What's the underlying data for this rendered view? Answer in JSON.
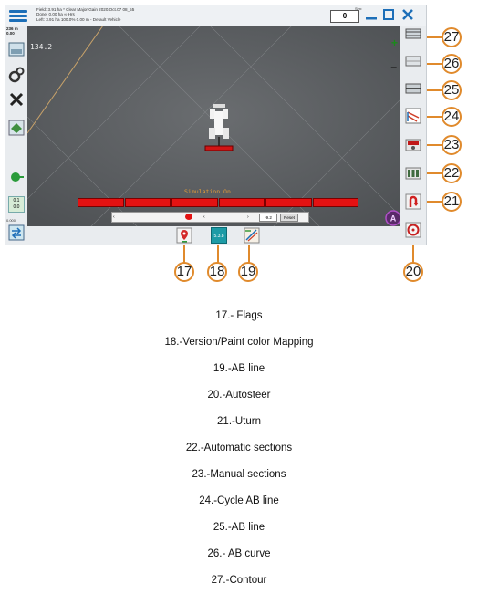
{
  "app": {
    "info_line1": "Field: 3.91 ha   * Clear Major Gain 2020.Oct.07 08_55",
    "info_line2": "Done: 0.00 ha  ∞ Hrs",
    "info_line3": "Left: 3.91 ha  100.0%      0.00 m - Default Vehicle",
    "sim_label": "Sim:",
    "counter": "0",
    "left_scale": "236 m",
    "left_value": "0.00",
    "heading": "134.2",
    "zoom_plus": "+",
    "zoom_minus": "–",
    "simulation_label": "Simulation On",
    "offset_label": "0.1",
    "offset_value": "0.0",
    "bottom_left_value": "0.000",
    "speed_value": "-9.2",
    "reset_label": "Reset",
    "version_label": "5.3.8"
  },
  "callouts": {
    "c17": "17",
    "c18": "18",
    "c19": "19",
    "c20": "20",
    "c21": "21",
    "c22": "22",
    "c23": "23",
    "c24": "24",
    "c25": "25",
    "c26": "26",
    "c27": "27"
  },
  "legend": [
    "17.- Flags",
    "18.-Version/Paint color Mapping",
    "19.-AB line",
    "20.-Autosteer",
    "21.-Uturn",
    "22.-Automatic sections",
    "23.-Manual sections",
    "24.-Cycle AB line",
    "25.-AB line",
    "26.- AB curve",
    "27.-Contour"
  ],
  "colors": {
    "accent_blue": "#1d6fb8",
    "callout_orange": "#e08a2c",
    "section_red": "#e31212",
    "field_gray": "#5c5f62"
  }
}
